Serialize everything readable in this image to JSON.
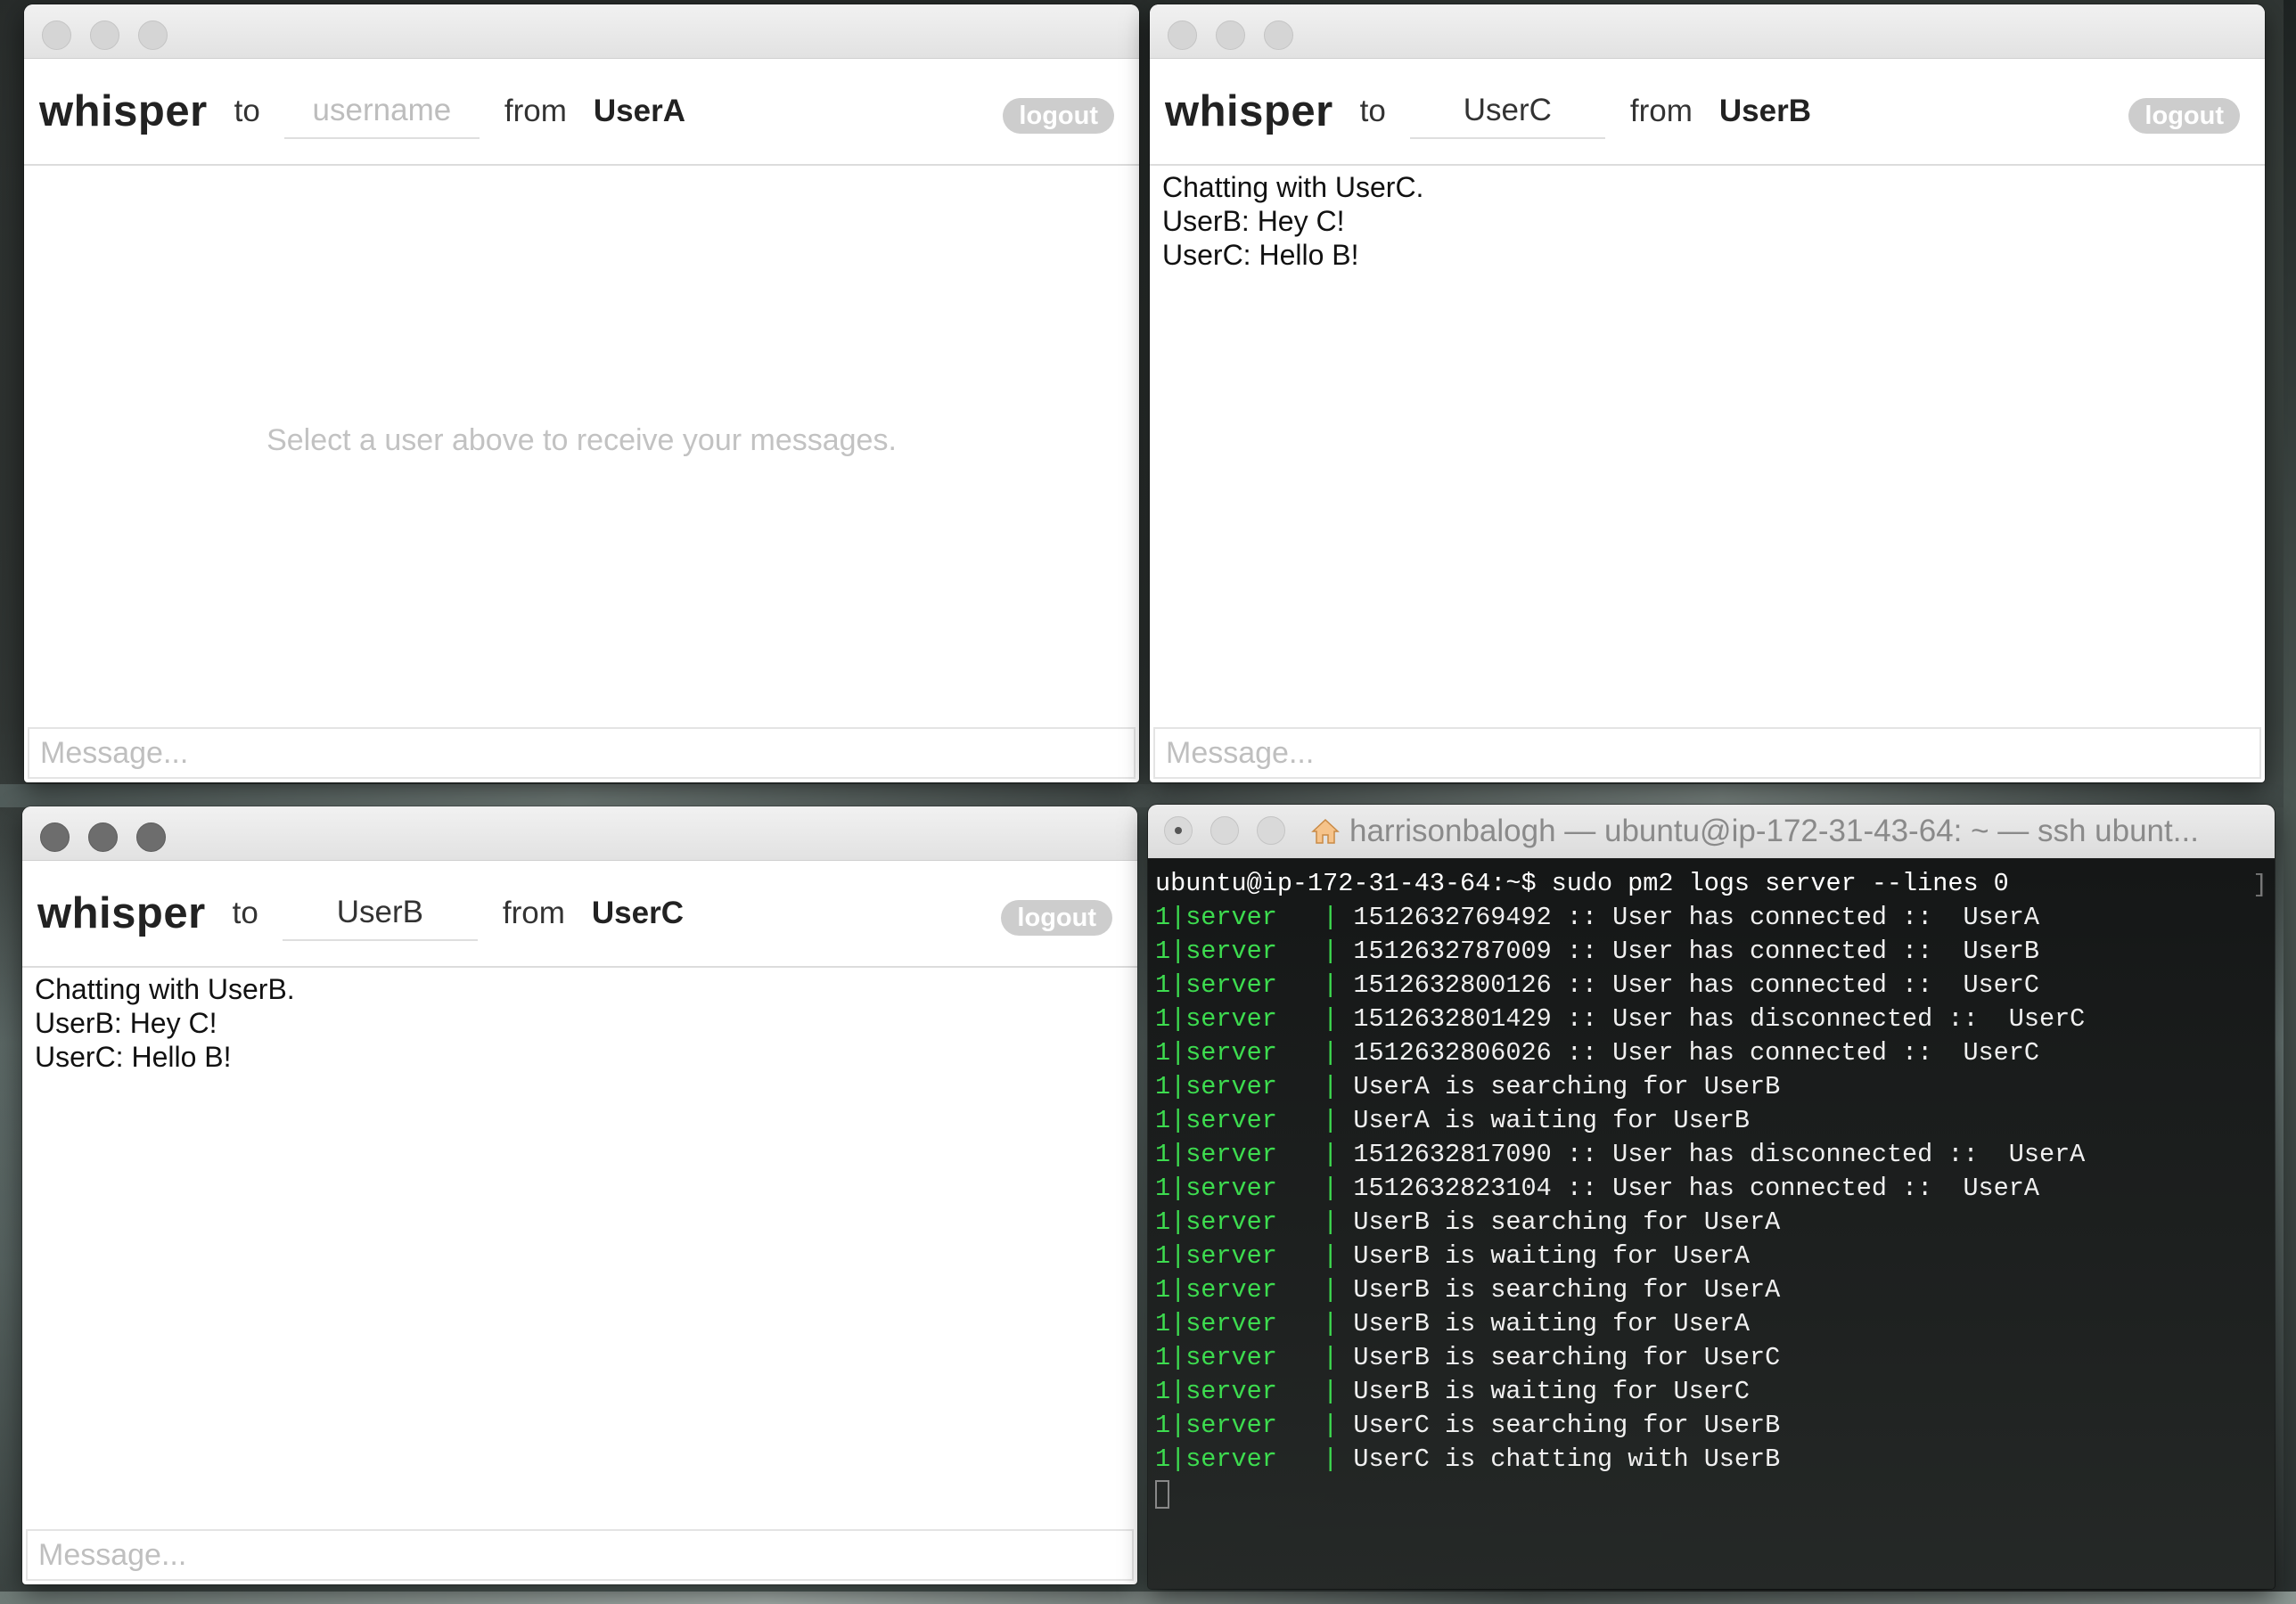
{
  "windows": [
    {
      "brand": "whisper",
      "to_label": "to",
      "to_value": "",
      "to_placeholder": "username",
      "from_label": "from",
      "from_user": "UserA",
      "logout_label": "logout",
      "empty_note": "Select a user above to receive your messages.",
      "messages": [],
      "compose_placeholder": "Message..."
    },
    {
      "brand": "whisper",
      "to_label": "to",
      "to_value": "UserC",
      "to_placeholder": "username",
      "from_label": "from",
      "from_user": "UserB",
      "logout_label": "logout",
      "messages": [
        "Chatting with UserC.",
        "UserB: Hey C!",
        "UserC: Hello B!"
      ],
      "compose_placeholder": "Message..."
    },
    {
      "brand": "whisper",
      "to_label": "to",
      "to_value": "UserB",
      "to_placeholder": "username",
      "from_label": "from",
      "from_user": "UserC",
      "logout_label": "logout",
      "messages": [
        "Chatting with UserB.",
        "UserB: Hey C!",
        "UserC: Hello B!"
      ],
      "compose_placeholder": "Message..."
    }
  ],
  "terminal": {
    "title": "harrisonbalogh — ubuntu@ip-172-31-43-64: ~ — ssh ubunt...",
    "prompt": "ubuntu@ip-172-31-43-64:~$ sudo pm2 logs server --lines 0",
    "scroll_mark": "]",
    "log_prefix": "1|server   | ",
    "logs": [
      "1512632769492 :: User has connected ::  UserA",
      "1512632787009 :: User has connected ::  UserB",
      "1512632800126 :: User has connected ::  UserC",
      "1512632801429 :: User has disconnected ::  UserC",
      "1512632806026 :: User has connected ::  UserC",
      "UserA is searching for UserB",
      "UserA is waiting for UserB",
      "1512632817090 :: User has disconnected ::  UserA",
      "1512632823104 :: User has connected ::  UserA",
      "UserB is searching for UserA",
      "UserB is waiting for UserA",
      "UserB is searching for UserA",
      "UserB is waiting for UserA",
      "UserB is searching for UserC",
      "UserB is waiting for UserC",
      "UserC is searching for UserB",
      "UserC is chatting with UserB"
    ],
    "colors": {
      "prefix": "#3ddc4f",
      "text": "#f0f0f0"
    }
  }
}
